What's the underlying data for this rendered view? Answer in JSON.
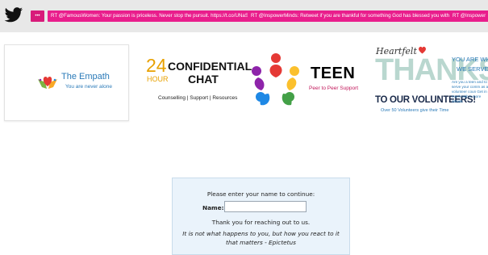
{
  "header": {
    "twitter_icon": "twitter-bird-icon",
    "ticker_chip": "•••",
    "tweets": [
      "RT @FamousWomen: Your passion is priceless. Never stop the pursuit. https://t.co/UNaSrybjM",
      "RT @InspowerMinds: Retweet if you are thankful for something God has blessed you with today!",
      "RT @Inspower"
    ],
    "tweet_color": "#e91e8c"
  },
  "banners": {
    "empath": {
      "title": "The Empath",
      "subtitle": "You are never alone",
      "icon": "hands-heart-icon"
    },
    "chat": {
      "number": "24",
      "hour": "HOUR",
      "title_line1": "CONFIDENTIAL",
      "title_line2": "CHAT",
      "subtitle": "Counselling | Support | Resources"
    },
    "teen": {
      "title": "TEEN",
      "subtitle": "Peer to Peer Support",
      "icon": "people-circle-icon"
    },
    "thanks": {
      "script": "Heartfelt",
      "big": "THANKS",
      "line": "TO OUR VOLUNTEERS!",
      "note": "Over 50 Volunteers give their Time"
    },
    "serve": {
      "title_line1": "YOU ARE WH",
      "title_line2": "WE SERVE",
      "body": "Are you a teen and to serve your comm as a volunteer coun Get in touch with u more details."
    }
  },
  "form": {
    "prompt": "Please enter your name to continue:",
    "name_label": "Name:",
    "name_value": "",
    "thanks": "Thank you for reaching out to us.",
    "quote": "It is not what happens to you, but how you react to it that matters - Epictetus",
    "panel_color": "#eaf3fb"
  }
}
